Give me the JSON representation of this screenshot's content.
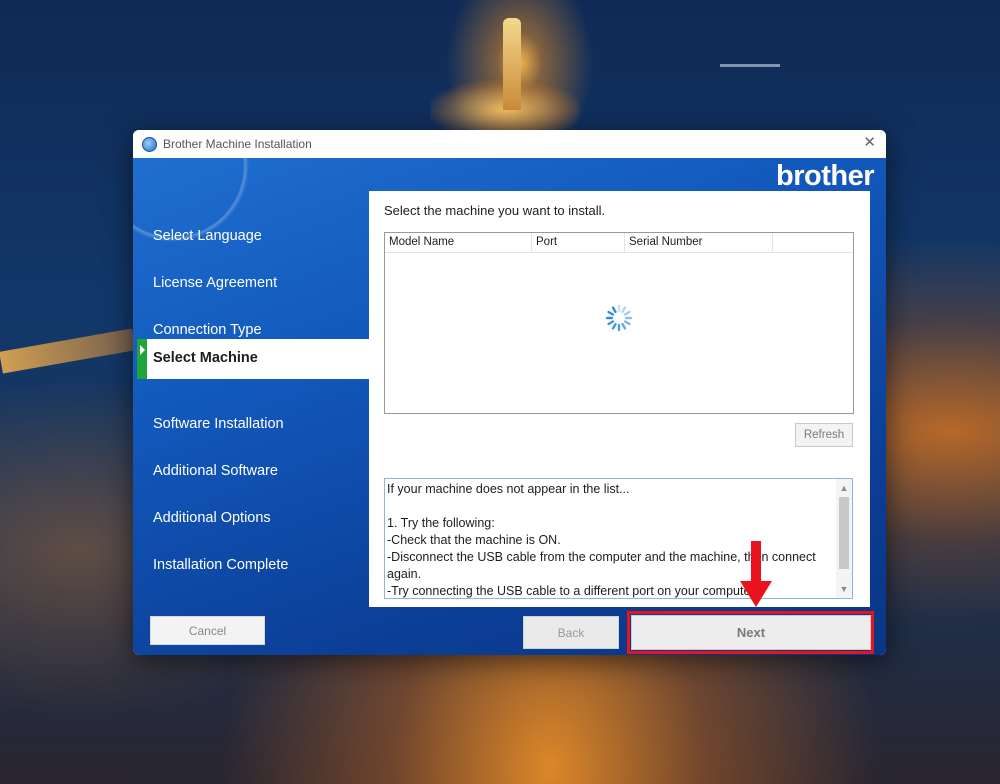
{
  "window": {
    "title": "Brother Machine Installation",
    "close_symbol": "✕",
    "brand_logo": "brother"
  },
  "steps": [
    {
      "label": "Select Language",
      "active": false
    },
    {
      "label": "License Agreement",
      "active": false
    },
    {
      "label": "Connection Type",
      "active": false
    },
    {
      "label": "Select Machine",
      "active": true
    },
    {
      "label": "Software Installation",
      "active": false
    },
    {
      "label": "Additional Software",
      "active": false
    },
    {
      "label": "Additional Options",
      "active": false
    },
    {
      "label": "Installation Complete",
      "active": false
    }
  ],
  "main": {
    "instruction": "Select the machine you want to install.",
    "columns": [
      "Model Name",
      "Port",
      "Serial Number"
    ],
    "refresh_label": "Refresh",
    "info_lines": [
      "If your machine does not appear in the list...",
      "",
      "1. Try the following:",
      "-Check that the machine is ON.",
      "-Disconnect the USB cable from the computer and the machine, then connect",
      "again.",
      "-Try connecting the USB cable to a different port on your computer."
    ]
  },
  "buttons": {
    "cancel": "Cancel",
    "back": "Back",
    "next": "Next"
  },
  "annotation": {
    "highlight_color": "#e8131d",
    "arrow_color": "#e8131d"
  },
  "colors": {
    "active_step_marker": "#1fa63a",
    "panel_blue": "#1258bb"
  }
}
